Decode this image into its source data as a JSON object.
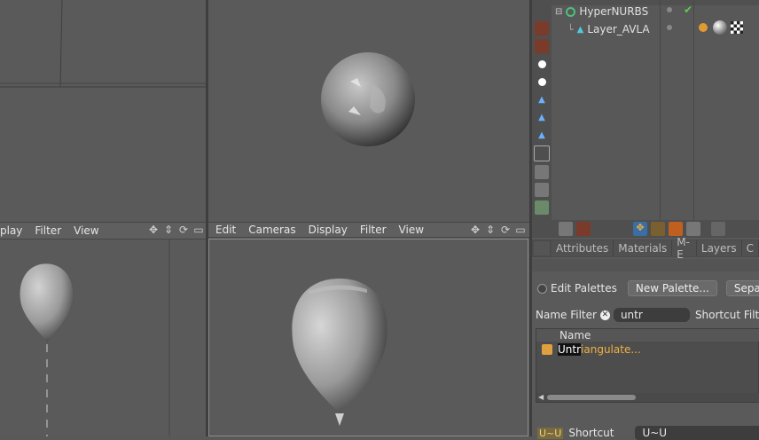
{
  "viewport_left": {
    "menu": [
      "play",
      "Filter",
      "View"
    ]
  },
  "viewport_right": {
    "menu": [
      "Edit",
      "Cameras",
      "Display",
      "Filter",
      "View"
    ]
  },
  "viewport_icons": {
    "move": "✥",
    "scale": "⇕",
    "rotate": "⟳",
    "maximize": "▭"
  },
  "object_manager": {
    "objects": [
      {
        "name": "HyperNURBS",
        "icon": "hypernurbs-icon"
      },
      {
        "name": "Layer_AVLA",
        "icon": "polygon-object-icon"
      }
    ],
    "check": "✔"
  },
  "panel_tabs": [
    "Attributes",
    "Materials",
    "M- E",
    "Layers",
    "C"
  ],
  "command_manager": {
    "edit_palettes_label": "Edit Palettes",
    "new_palette_label": "New Palette...",
    "separate_label": "Separat",
    "name_filter_label": "Name Filter",
    "name_filter_value": "untr",
    "shortcut_filter_label": "Shortcut Filter",
    "column_name": "Name",
    "result_highlight": "Untr",
    "result_rest": "iangulate...",
    "shortcut_key": "U~U",
    "shortcut_label": "Shortcut",
    "shortcut_value": "U~U"
  },
  "colors": {
    "background": "#595959",
    "accent_orange": "#f0b040",
    "selection_blue": "#3a6ea5"
  }
}
